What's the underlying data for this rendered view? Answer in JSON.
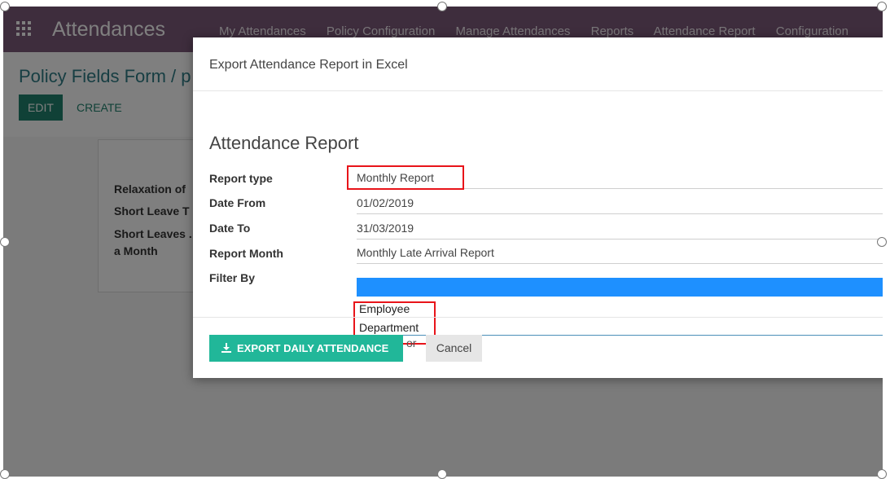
{
  "navbar": {
    "app_title": "Attendances",
    "menu": [
      "My Attendances",
      "Policy Configuration",
      "Manage Attendances",
      "Reports",
      "Attendance Report",
      "Configuration"
    ]
  },
  "control_panel": {
    "breadcrumb": "Policy Fields Form /  p",
    "edit_label": "EDIT",
    "create_label": "CREATE"
  },
  "sheet": {
    "rows": [
      "Relaxation of",
      "Short Leave T",
      "Short Leaves .",
      "a Month"
    ]
  },
  "modal": {
    "title": "Export Attendance Report in Excel",
    "form_title": "Attendance Report",
    "fields": [
      {
        "label": "Report type",
        "value": "Monthly Report"
      },
      {
        "label": "Date From",
        "value": "01/02/2019"
      },
      {
        "label": "Date To",
        "value": "31/03/2019"
      },
      {
        "label": "Report Month",
        "value": "Monthly Late Arrival Report"
      },
      {
        "label": "Filter By",
        "value": ""
      }
    ],
    "filter_options": [
      "Employee",
      "Department"
    ],
    "export_label": "EXPORT DAILY ATTENDANCE",
    "or_text": "or",
    "cancel_label": "Cancel"
  },
  "colors": {
    "navbar": "#7c5a7a",
    "primary": "#20826f",
    "export": "#21b799",
    "highlight": "#e8141a",
    "selection": "#1e90ff"
  }
}
